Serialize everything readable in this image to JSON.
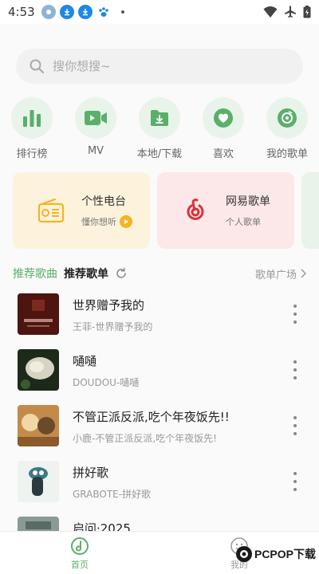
{
  "status": {
    "time": "4:53"
  },
  "search": {
    "placeholder": "搜你想搜~"
  },
  "quick": [
    {
      "label": "排行榜",
      "icon": "bar-chart-icon"
    },
    {
      "label": "MV",
      "icon": "video-icon"
    },
    {
      "label": "本地/下载",
      "icon": "download-folder-icon"
    },
    {
      "label": "喜欢",
      "icon": "heart-icon"
    },
    {
      "label": "我的歌单",
      "icon": "disc-icon"
    }
  ],
  "cards": {
    "radio": {
      "title": "个性电台",
      "sub": "懂你想听"
    },
    "netease": {
      "title": "网易歌单",
      "sub": "个人歌单"
    }
  },
  "tabs": {
    "active": "推荐歌曲",
    "other": "推荐歌单",
    "more": "歌单广场"
  },
  "songs": [
    {
      "title": "世界赠予我的",
      "sub": "王菲-世界赠予我的"
    },
    {
      "title": "嗵嗵",
      "sub": "DOUDOU-嗵嗵"
    },
    {
      "title": "不管正派反派,吃个年夜饭先!!",
      "sub": "小鹿-不管正派反派,吃个年夜饭先!"
    },
    {
      "title": "拼好歌",
      "sub": "GRABOTE-拼好歌"
    },
    {
      "title": "启问·2025",
      "sub": ""
    }
  ],
  "nav": {
    "home": "首页",
    "mine": "我的"
  },
  "watermark": {
    "text": "PCPOP下载"
  },
  "colors": {
    "accent": "#5aaf6a",
    "radio_bg": "#fdf3dc",
    "netease_bg": "#fce8e8",
    "netease_red": "#d9333a",
    "radio_yellow": "#f5b324"
  }
}
